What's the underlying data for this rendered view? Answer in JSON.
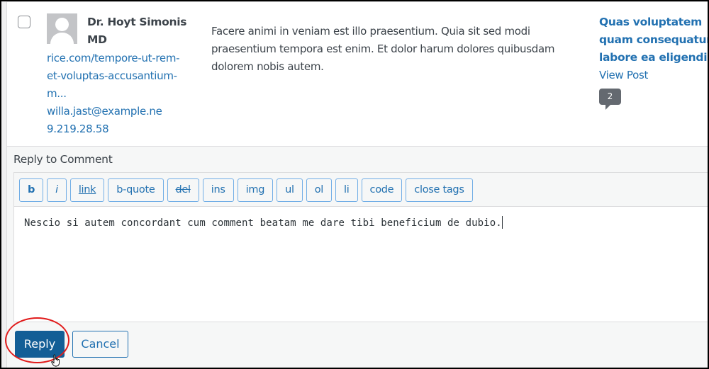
{
  "comment": {
    "author_name": "Dr. Hoyt Simonis MD",
    "author_url_lines": [
      "rice.com/tempore-ut-rem-",
      "et-voluptas-accusantium-",
      "m..."
    ],
    "author_email": "willa.jast@example.ne",
    "author_ip": "9.219.28.58",
    "text": "Facere animi in veniam est illo praesentium. Quia sit sed modi praesentium tempora est enim. Et dolor harum dolores quibusdam dolorem nobis autem.",
    "post_title": "Quas voluptatem quam consequatur labore ea eligendi",
    "view_post_label": "View Post",
    "comment_count": "2"
  },
  "reply": {
    "title": "Reply to Comment",
    "toolbar": [
      {
        "id": "b",
        "label": "b"
      },
      {
        "id": "i",
        "label": "i"
      },
      {
        "id": "link",
        "label": "link"
      },
      {
        "id": "b-quote",
        "label": "b-quote"
      },
      {
        "id": "del",
        "label": "del"
      },
      {
        "id": "ins",
        "label": "ins"
      },
      {
        "id": "img",
        "label": "img"
      },
      {
        "id": "ul",
        "label": "ul"
      },
      {
        "id": "ol",
        "label": "ol"
      },
      {
        "id": "li",
        "label": "li"
      },
      {
        "id": "code",
        "label": "code"
      },
      {
        "id": "close-tags",
        "label": "close tags"
      }
    ],
    "textarea_value": "Nescio si autem concordant cum comment beatam me dare tibi beneficium de dubio.",
    "reply_label": "Reply",
    "cancel_label": "Cancel"
  },
  "colors": {
    "accent": "#2271b1",
    "primary_button": "#135e96",
    "highlight": "#e11b1b"
  }
}
